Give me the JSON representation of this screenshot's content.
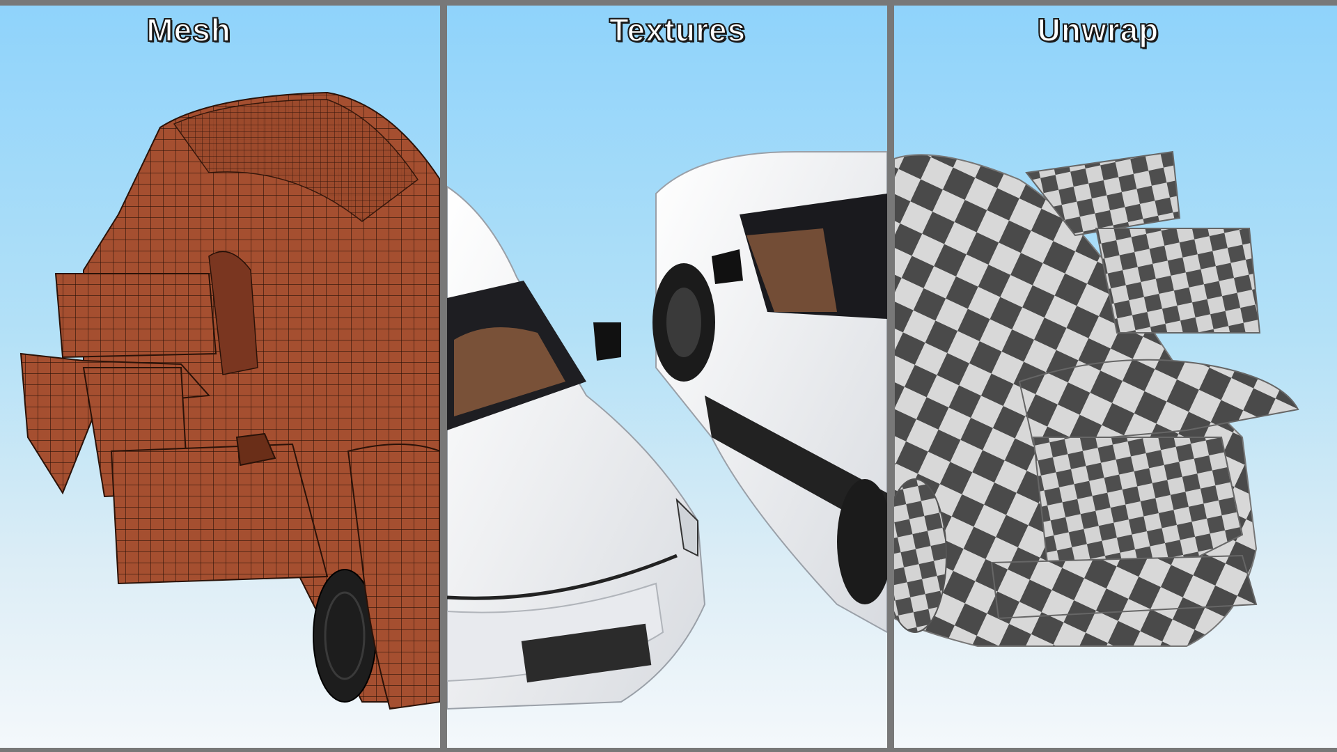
{
  "panels": [
    {
      "title": "Mesh"
    },
    {
      "title": "Textures"
    },
    {
      "title": "Unwrap"
    }
  ],
  "colors": {
    "mesh": "#a54f30",
    "wire": "#2a1208",
    "body_white": "#f2f3f5",
    "interior": "#8a5a3c",
    "checker_dark": "#4a4a4a",
    "checker_light": "#d8d8d8",
    "divider": "#787878"
  }
}
